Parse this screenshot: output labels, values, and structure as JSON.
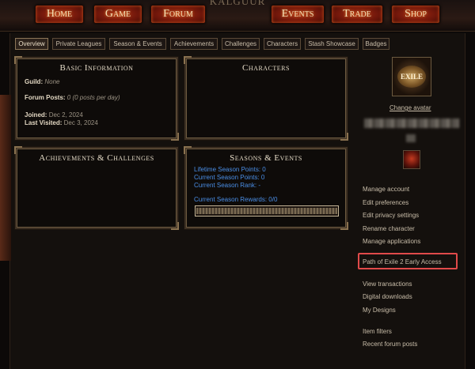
{
  "logo": {
    "text": "KALGUUR"
  },
  "nav": {
    "home": "Home",
    "game": "Game",
    "forum": "Forum",
    "events": "Events",
    "trade": "Trade",
    "shop": "Shop"
  },
  "tabs": [
    {
      "label": "Overview",
      "active": true
    },
    {
      "label": "Private Leagues"
    },
    {
      "label": "Season & Events"
    },
    {
      "label": "Achievements"
    },
    {
      "label": "Challenges"
    },
    {
      "label": "Characters"
    },
    {
      "label": "Stash Showcase"
    },
    {
      "label": "Badges"
    }
  ],
  "basic": {
    "title": "Basic Information",
    "guild_label": "Guild:",
    "guild_value": "None",
    "posts_label": "Forum Posts:",
    "posts_value": "0 (0 posts per day)",
    "joined_label": "Joined:",
    "joined_value": "Dec 2, 2024",
    "visited_label": "Last Visited:",
    "visited_value": "Dec 3, 2024"
  },
  "characters": {
    "title": "Characters"
  },
  "achievements": {
    "title": "Achievements & Challenges"
  },
  "seasons": {
    "title": "Seasons & Events",
    "lifetime": "Lifetime Season Points: 0",
    "current_points": "Current Season Points: 0",
    "current_rank": "Current Season Rank: -",
    "rewards": "Current Season Rewards: 0/0",
    "progress": 0
  },
  "sidebar": {
    "avatar_text": "EXILE",
    "change_avatar": "Change avatar",
    "links": [
      "Manage account",
      "Edit preferences",
      "Edit privacy settings",
      "Rename character",
      "Manage applications",
      "Path of Exile 2 Early Access",
      "View transactions",
      "Digital downloads",
      "My Designs",
      "Item filters",
      "Recent forum posts"
    ]
  },
  "colors": {
    "link_blue": "#4a8ee6",
    "highlight_red": "#e04a4a",
    "nav_red": "#a52a12"
  }
}
